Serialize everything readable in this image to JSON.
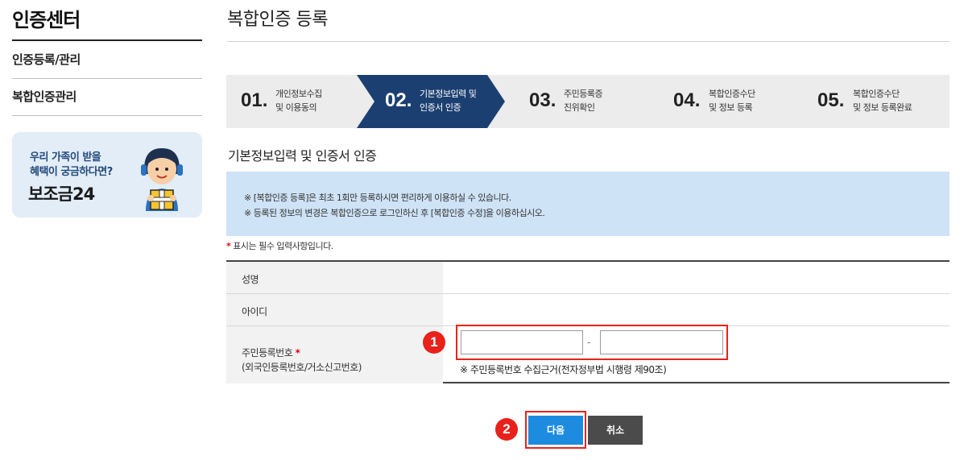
{
  "sidebar": {
    "title": "인증센터",
    "items": [
      {
        "label": "인증등록/관리"
      },
      {
        "label": "복합인증관리"
      }
    ],
    "banner": {
      "line1": "우리 가족이 받을",
      "line2": "혜택이 궁금하다면?",
      "brand": "보조금24"
    }
  },
  "main": {
    "title": "복합인증 등록",
    "steps": [
      {
        "num": "01.",
        "line1": "개인정보수집",
        "line2": "및 이용동의",
        "active": false
      },
      {
        "num": "02.",
        "line1": "기본정보입력 및",
        "line2": "인증서 인증",
        "active": true
      },
      {
        "num": "03.",
        "line1": "주민등록증",
        "line2": "진위확인",
        "active": false
      },
      {
        "num": "04.",
        "line1": "복합인증수단",
        "line2": "및 정보 등록",
        "active": false
      },
      {
        "num": "05.",
        "line1": "복합인증수단",
        "line2": "및 정보 등록완료",
        "active": false
      }
    ],
    "section_title": "기본정보입력 및 인증서 인증",
    "notices": [
      "※ [복합인증 등록]은 최초 1회만 등록하시면 편리하게 이용하실 수 있습니다.",
      "※ 등록된 정보의 변경은 복합인증으로 로그인하신 후 [복합인증 수정]을 이용하십시오."
    ],
    "required_note": {
      "star": "*",
      "text": " 표시는 필수 입력사항입니다."
    },
    "form": {
      "name_label": "성명",
      "id_label": "아이디",
      "rrn_label": "주민등록번호",
      "rrn_star": "*",
      "rrn_sublabel": "(외국인등록번호/거소신고번호)",
      "rrn_front": "",
      "rrn_back": "",
      "rrn_separator": "-",
      "rrn_note": "※ 주민등록번호 수집근거(전자정부법 시행령 제90조)"
    },
    "buttons": {
      "next": "다음",
      "cancel": "취소"
    },
    "markers": [
      "1",
      "2"
    ]
  },
  "colors": {
    "active_step": "#1b3f70",
    "notice_bg": "#cfe3f6",
    "next_button": "#1d8ce0",
    "cancel_button": "#4b4b4b",
    "highlight": "#e8221b",
    "banner_bg": "#e2edf8"
  },
  "icons": {
    "mascot": "mascot-holding-gift-icon"
  }
}
